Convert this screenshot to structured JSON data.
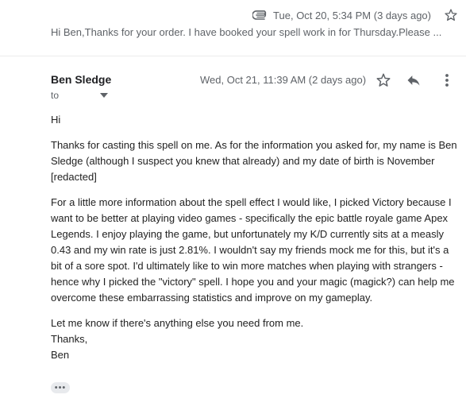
{
  "previous_message": {
    "date": "Tue, Oct 20, 5:34 PM (3 days ago)",
    "snippet": "Hi Ben,Thanks for your order. I have booked your spell work in for Thursday.Please ..."
  },
  "message": {
    "sender": "Ben Sledge",
    "to_label": "to",
    "date": "Wed, Oct 21, 11:39 AM (2 days ago)",
    "greeting": "Hi",
    "para1": "Thanks for casting this spell on me. As for the information you asked for, my name is Ben Sledge (although I suspect you knew that already) and my date of birth is November [redacted]",
    "para2": "For a little more information about the spell effect I would like, I picked Victory because I want to be better at playing video games - specifically the epic battle royale game Apex Legends. I enjoy playing the game, but unfortunately my K/D currently sits at a measly 0.43 and my win rate is just 2.81%. I wouldn't say my friends mock me for this, but it's a bit of a sore spot. I'd ultimately like to win more matches when playing with strangers - hence why I picked the \"victory\" spell. I hope you and your magic (magick?) can help me overcome these embarrassing statistics and improve on my gameplay.",
    "closing_line": "Let me know if there's anything else you need from me.",
    "thanks": "Thanks,",
    "signature": "Ben",
    "ellipsis": "•••"
  },
  "icons": {
    "attachment": "paperclip-icon",
    "star": "star-icon",
    "reply": "reply-icon",
    "more": "more-vert-icon",
    "caret": "chevron-down-icon"
  }
}
